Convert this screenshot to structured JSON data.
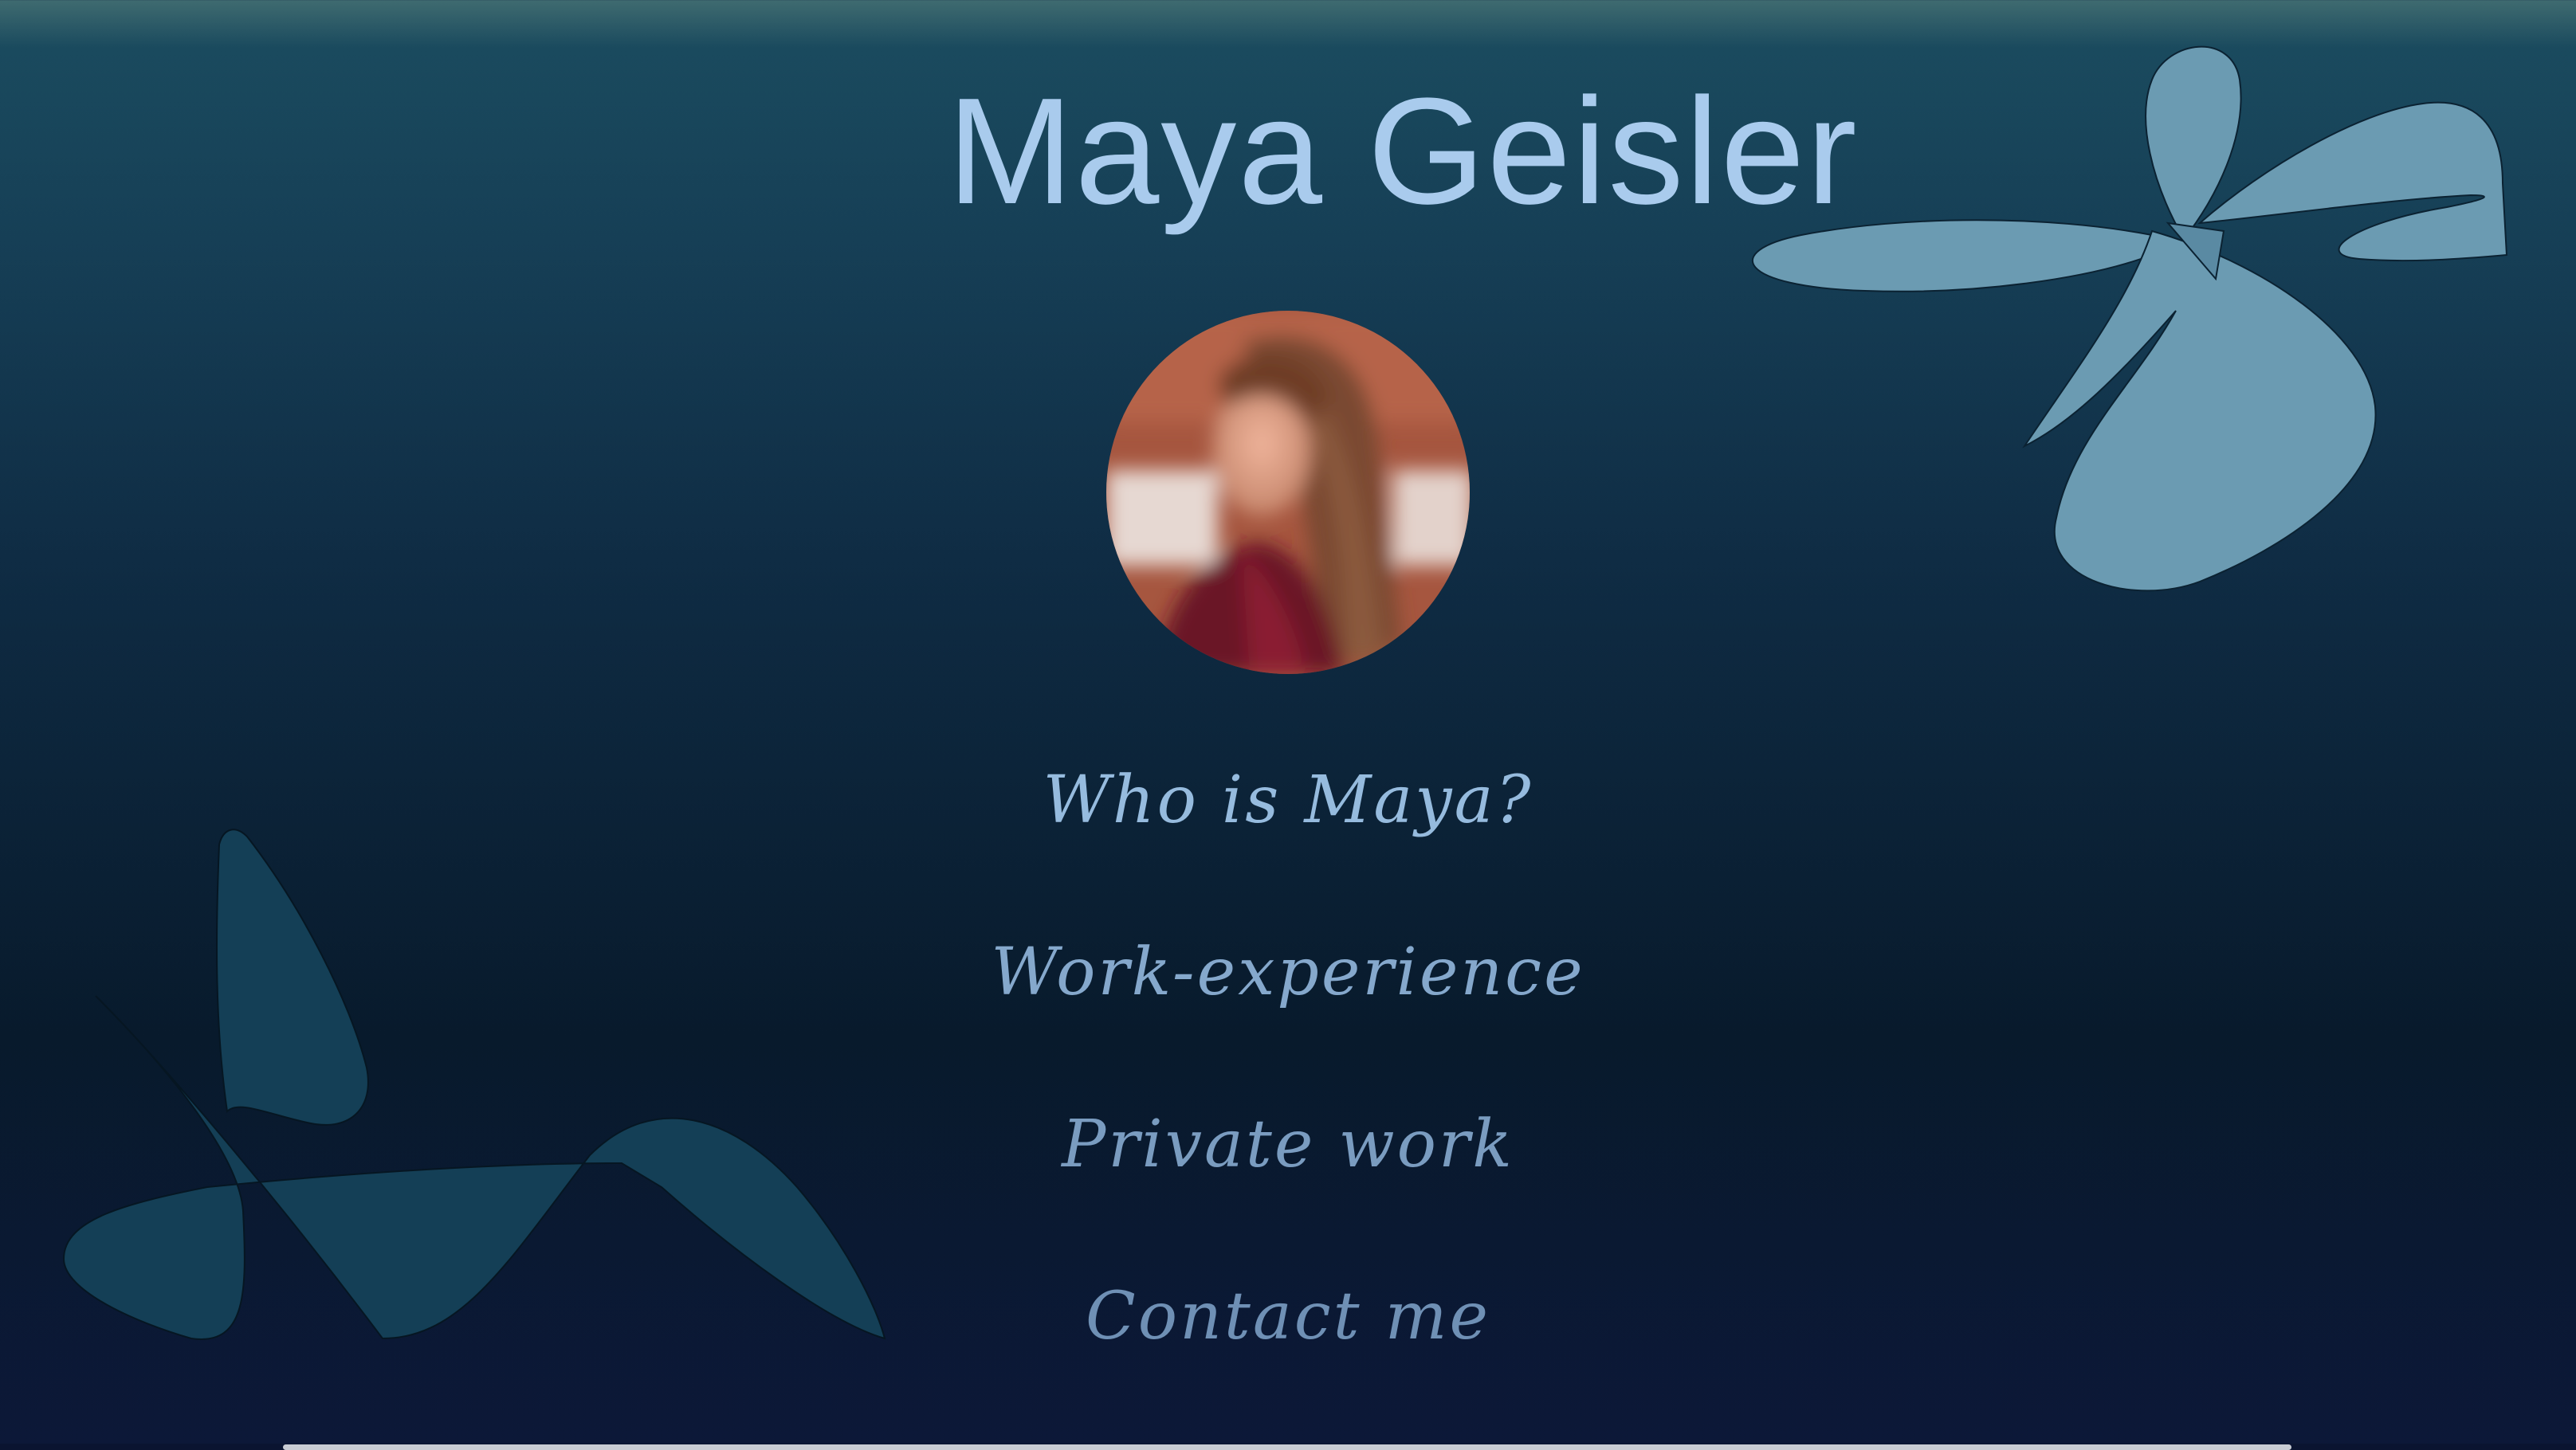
{
  "header": {
    "name": "Maya Geisler"
  },
  "profile": {
    "avatar_icon": "profile-photo"
  },
  "nav": {
    "items": [
      {
        "label": "Who is Maya?"
      },
      {
        "label": "Work-experience"
      },
      {
        "label": "Private work"
      },
      {
        "label": "Contact me"
      }
    ]
  },
  "colors": {
    "title": "#a9cbed",
    "nav_text": "#8fb2d6",
    "deco_light": "#6b9bb2",
    "deco_dark": "#143f56"
  }
}
